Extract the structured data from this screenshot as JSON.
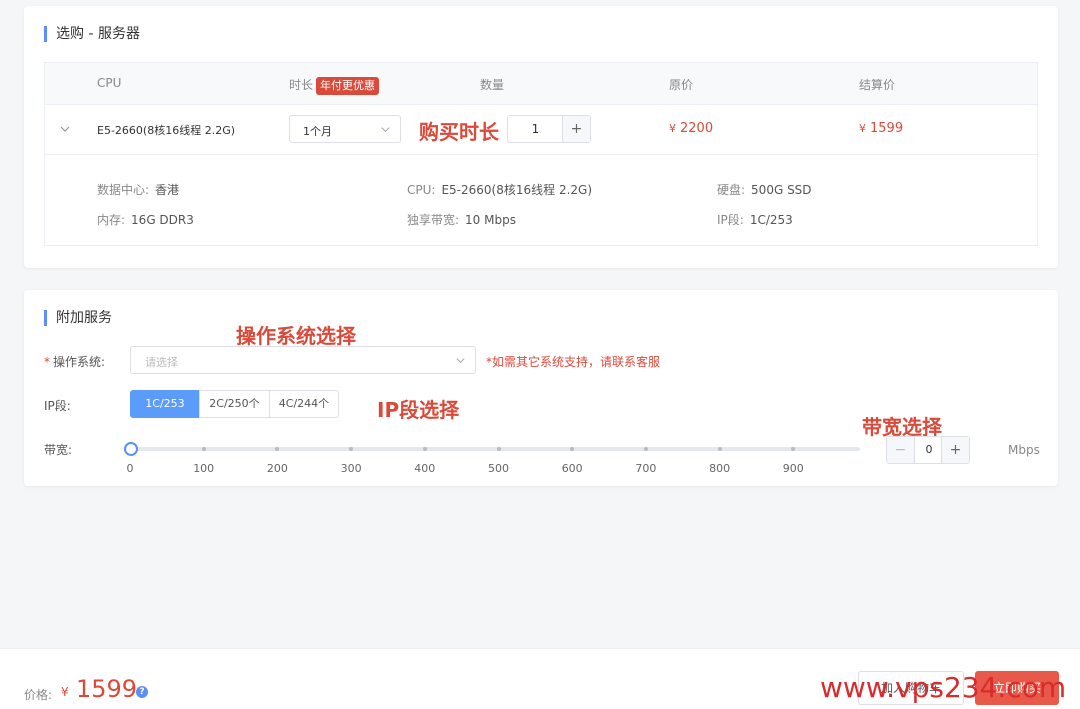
{
  "server_card": {
    "title": "选购 - 服务器",
    "table_headers": {
      "cpu": "CPU",
      "duration": "时长",
      "duration_badge": "年付更优惠",
      "quantity": "数量",
      "original_price": "原价",
      "final_price": "结算价"
    },
    "row": {
      "cpu": "E5-2660(8核16线程 2.2G)",
      "duration": "1个月",
      "quantity": "1",
      "original_currency": "¥",
      "original_price": "2200",
      "final_currency": "¥",
      "final_price": "1599"
    },
    "annotation_duration": "购买时长",
    "details": [
      {
        "key": "数据中心:",
        "value": "香港"
      },
      {
        "key": "CPU:",
        "value": "E5-2660(8核16线程 2.2G)"
      },
      {
        "key": "硬盘:",
        "value": "500G SSD"
      },
      {
        "key": "内存:",
        "value": "16G DDR3"
      },
      {
        "key": "独享带宽:",
        "value": "10 Mbps"
      },
      {
        "key": "IP段:",
        "value": "1C/253"
      }
    ]
  },
  "extra_card": {
    "title": "附加服务",
    "os": {
      "required_mark": "*",
      "label": "操作系统:",
      "placeholder": "请选择",
      "note": "*如需其它系统支持，请联系客服",
      "annotation": "操作系统选择"
    },
    "ip": {
      "label": "IP段:",
      "options": [
        "1C/253",
        "2C/250个",
        "4C/244个"
      ],
      "selected": "1C/253",
      "annotation": "IP段选择"
    },
    "bandwidth": {
      "label": "带宽:",
      "ticks": [
        "0",
        "100",
        "200",
        "300",
        "400",
        "500",
        "600",
        "700",
        "800",
        "900"
      ],
      "max": 1000,
      "value": 0,
      "value_text": "0",
      "minus": "−",
      "plus": "+",
      "unit": "Mbps",
      "annotation": "带宽选择"
    }
  },
  "footer": {
    "total_label": "价格:",
    "currency": "¥",
    "total": "1599",
    "help": "?",
    "cart_button": "加入购物车",
    "buy_button": "立即购买",
    "watermark": "www.vps234.com"
  },
  "icons": {
    "expand": "chevron-down-icon",
    "select": "chevron-down-icon",
    "help": "question-circle-icon"
  },
  "colors": {
    "accent": "#5b8ff9",
    "price": "#d94a3a",
    "buy_button": "#e9594a"
  }
}
